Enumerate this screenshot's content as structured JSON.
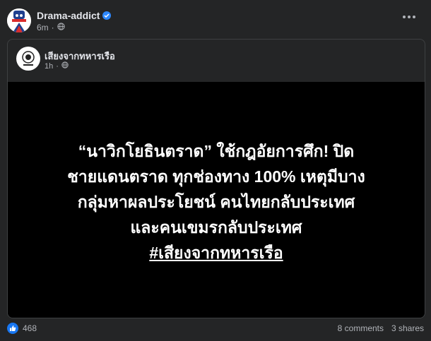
{
  "post": {
    "author": "Drama-addict",
    "time": "6m",
    "dot": "·"
  },
  "shared_post": {
    "page_name": "เสียงจากทหารเรือ",
    "time": "1h",
    "dot": "·",
    "image_text": {
      "line1": "“นาวิกโยธินตราด” ใช้กฎอัยการศึก! ปิด",
      "line2": "ชายแดนตราด ทุกช่องทาง 100% เหตุมีบาง",
      "line3": "กลุ่มหาผลประโยชน์ คนไทยกลับประเทศ",
      "line4": "และคนเขมรกลับประเทศ",
      "hashtag": "#เสียงจากทหารเรือ"
    }
  },
  "footer": {
    "like_count": "468",
    "comments": "8 comments",
    "shares": "3 shares"
  },
  "colors": {
    "background": "#242526",
    "accent": "#1877f2",
    "verified": "#2d88ff"
  },
  "icons": [
    "globe-icon",
    "verified-badge-icon",
    "more-options-icon",
    "like-reaction-icon"
  ]
}
